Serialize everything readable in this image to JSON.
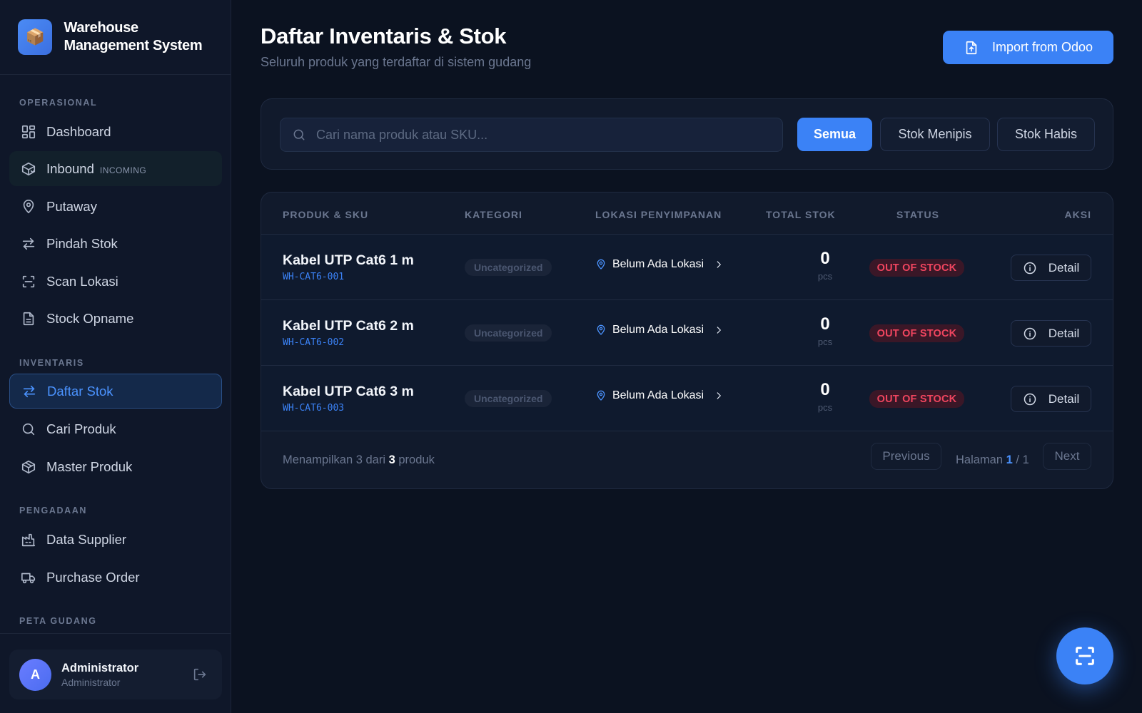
{
  "app": {
    "logo_icon": "📦",
    "title": "Warehouse Management System"
  },
  "sidebar": {
    "sections": [
      {
        "label": "OPERASIONAL"
      },
      {
        "label": "INVENTARIS"
      },
      {
        "label": "PENGADAAN"
      },
      {
        "label": "PETA GUDANG"
      }
    ],
    "items": [
      {
        "label": "Dashboard",
        "icon": "dashboard-icon"
      },
      {
        "label": "Inbound",
        "badge": "INCOMING",
        "icon": "package-inbound-icon"
      },
      {
        "label": "Putaway",
        "icon": "map-pin-icon"
      },
      {
        "label": "Pindah Stok",
        "icon": "arrows-transfer-icon"
      },
      {
        "label": "Scan Lokasi",
        "icon": "scan-icon"
      },
      {
        "label": "Stock Opname",
        "icon": "document-icon"
      },
      {
        "label": "Daftar Stok",
        "icon": "arrows-transfer-icon",
        "active": true
      },
      {
        "label": "Cari Produk",
        "icon": "search-icon"
      },
      {
        "label": "Master Produk",
        "icon": "box-icon"
      },
      {
        "label": "Data Supplier",
        "icon": "factory-icon"
      },
      {
        "label": "Purchase Order",
        "icon": "truck-icon"
      }
    ],
    "user": {
      "initial": "A",
      "name": "Administrator",
      "role": "Administrator"
    }
  },
  "header": {
    "title": "Daftar Inventaris & Stok",
    "subtitle": "Seluruh produk yang terdaftar di sistem gudang",
    "import_label": "Import from Odoo"
  },
  "filters": {
    "search_placeholder": "Cari nama produk atau SKU...",
    "search_value": "",
    "chips": [
      "Semua",
      "Stok Menipis",
      "Stok Habis"
    ],
    "active_chip": "Semua"
  },
  "table": {
    "columns": [
      "PRODUK & SKU",
      "KATEGORI",
      "LOKASI PENYIMPANAN",
      "TOTAL STOK",
      "STATUS",
      "AKSI"
    ],
    "rows": [
      {
        "name": "Kabel UTP Cat6 1 m",
        "sku": "WH-CAT6-001",
        "category": "Uncategorized",
        "location": "Belum Ada Lokasi",
        "stock": "0",
        "unit": "pcs",
        "status": "OUT OF STOCK",
        "action": "Detail"
      },
      {
        "name": "Kabel UTP Cat6 2 m",
        "sku": "WH-CAT6-002",
        "category": "Uncategorized",
        "location": "Belum Ada Lokasi",
        "stock": "0",
        "unit": "pcs",
        "status": "OUT OF STOCK",
        "action": "Detail"
      },
      {
        "name": "Kabel UTP Cat6 3 m",
        "sku": "WH-CAT6-003",
        "category": "Uncategorized",
        "location": "Belum Ada Lokasi",
        "stock": "0",
        "unit": "pcs",
        "status": "OUT OF STOCK",
        "action": "Detail"
      }
    ],
    "footer": {
      "showing_prefix": "Menampilkan 3 dari",
      "showing_total": "3",
      "showing_suffix": "produk",
      "prev_label": "Previous",
      "page_prefix": "Halaman",
      "page_current": "1",
      "page_sep": "/ 1",
      "next_label": "Next"
    }
  },
  "colors": {
    "accent": "#3b82f6",
    "danger": "#f0455f",
    "background": "#0b1220"
  }
}
